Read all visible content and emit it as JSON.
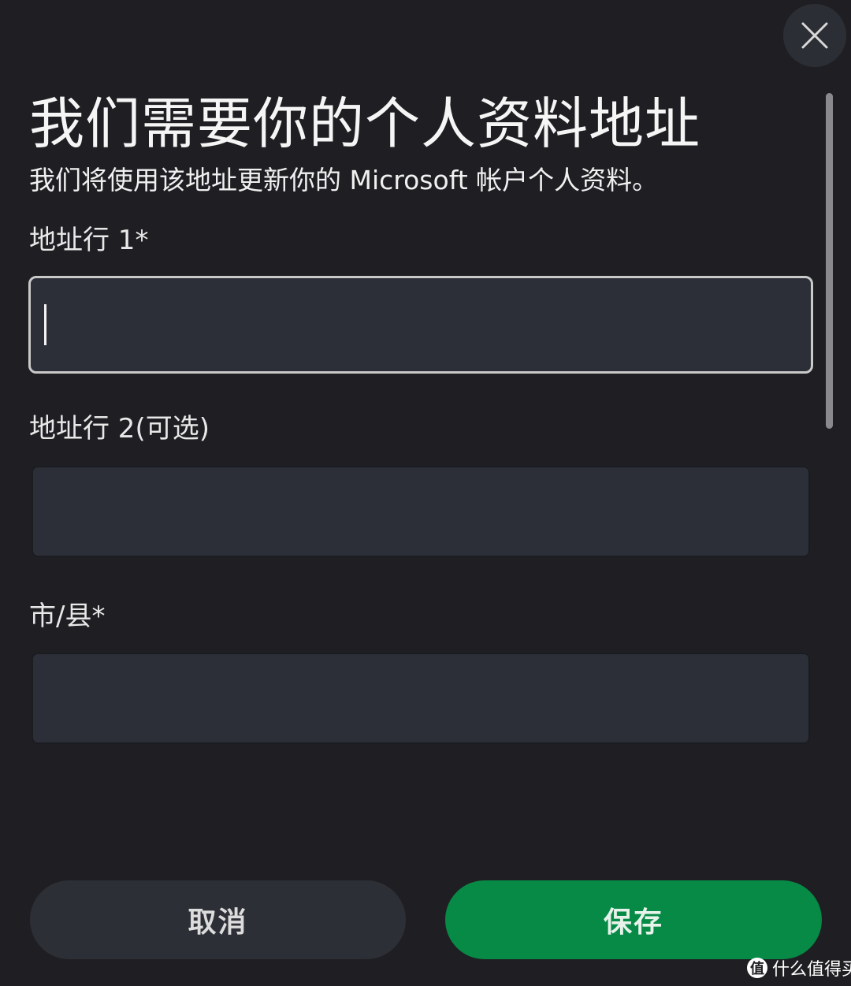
{
  "dialog": {
    "title": "我们需要你的个人资料地址",
    "subtitle": "我们将使用该地址更新你的 Microsoft 帐户个人资料。",
    "close_icon": "close-icon"
  },
  "form": {
    "fields": [
      {
        "label": "地址行 1*",
        "value": "",
        "focused": true
      },
      {
        "label": "地址行 2(可选)",
        "value": "",
        "focused": false
      },
      {
        "label": "市/县*",
        "value": "",
        "focused": false
      }
    ]
  },
  "actions": {
    "cancel_label": "取消",
    "save_label": "保存"
  },
  "colors": {
    "background": "#1f1f23",
    "input_background": "#2c2f38",
    "focus_border": "#c9c9c9",
    "save_button": "#068a46",
    "cancel_button": "#2d2f36"
  },
  "watermark": {
    "logo_glyph": "值",
    "text": "什么值得买"
  }
}
